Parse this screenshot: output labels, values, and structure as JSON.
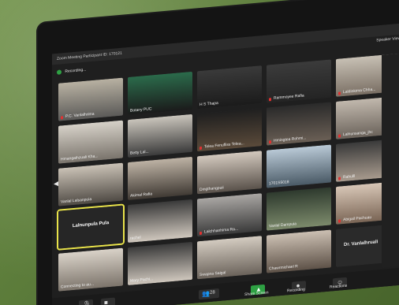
{
  "window": {
    "title": "Zoom Meeting Participant ID: 170121",
    "recording": "Recording...",
    "speaker_view": "Speaker View"
  },
  "participants": [
    {
      "name": "P.C. Vanlalhrima",
      "muted": true
    },
    {
      "name": "Botany PUC",
      "muted": false
    },
    {
      "name": "H S Thapa",
      "muted": false
    },
    {
      "name": "Rammoyee Rafia",
      "muted": true
    },
    {
      "name": "Laldinkima Chha...",
      "muted": true
    },
    {
      "name": "Hmangaihzuali Kha...",
      "muted": false
    },
    {
      "name": "Betty Lal...",
      "muted": false
    },
    {
      "name": "Telea Fenufliss Telea...",
      "muted": true
    },
    {
      "name": "Hmingtea Rohmi...",
      "muted": true
    },
    {
      "name": "Lalnunsanga_jhc",
      "muted": true
    },
    {
      "name": "Vanlal Lalsanpuia",
      "muted": false
    },
    {
      "name": "Akimal Rafia",
      "muted": false
    },
    {
      "name": "Dingthangpuii",
      "muted": false
    },
    {
      "name": "1701S5018",
      "muted": false
    },
    {
      "name": "Rahulll",
      "muted": true
    },
    {
      "name": "Lalnunpula Pula",
      "muted": false,
      "selected": true
    },
    {
      "name": "rachel",
      "muted": false
    },
    {
      "name": "Lalchhanhima Ra...",
      "muted": true
    },
    {
      "name": "Vanlal Dampuia",
      "muted": false
    },
    {
      "name": "Abigail Pachuau",
      "muted": true
    },
    {
      "name": "Connecting to au...",
      "muted": false
    },
    {
      "name": "Mary Pachi...",
      "muted": false
    },
    {
      "name": "Swapna Saigal",
      "muted": false
    },
    {
      "name": "Chawrmichael R",
      "muted": false
    },
    {
      "name": "Dr. Vanlalhruali",
      "muted": false
    }
  ],
  "toolbar": {
    "participants_count": "28",
    "share_screen": "Share Screen",
    "recording_label": "Recording",
    "reactions": "Reactions"
  },
  "colors": {
    "wall": "#5f7f3f",
    "bezel": "#141414",
    "screen_bg": "#1f1f1f",
    "active_speaker": "#e9e34a",
    "mute_red": "#e03131",
    "share_green": "#2ea043"
  }
}
